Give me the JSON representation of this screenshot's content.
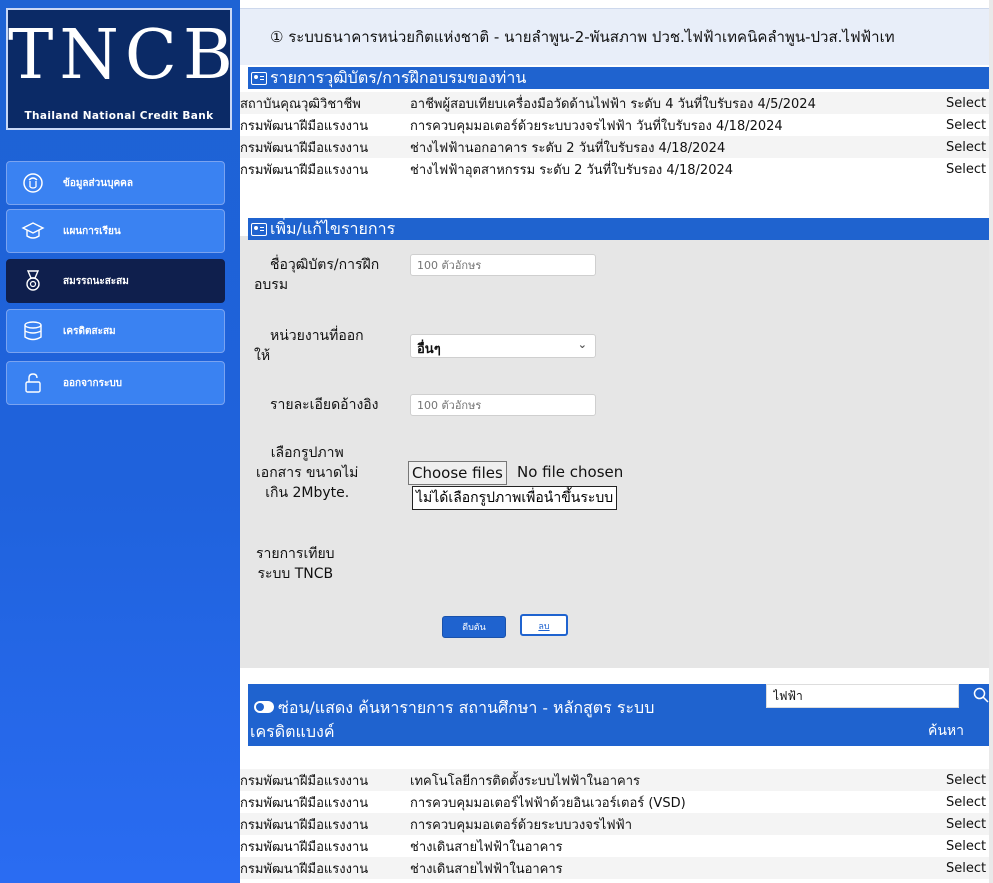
{
  "logo": {
    "title": "TNCB",
    "subtitle": "Thailand National Credit Bank"
  },
  "sidebar": {
    "items": [
      {
        "label": "ข้อมูลส่วนบุคคล",
        "icon": "profile-icon"
      },
      {
        "label": "แผนการเรียน",
        "icon": "graduation-cap-icon"
      },
      {
        "label": "สมรรถนะสะสม",
        "icon": "medal-icon",
        "active": true
      },
      {
        "label": "เครดิตสะสม",
        "icon": "database-icon"
      },
      {
        "label": "ออกจากระบบ",
        "icon": "unlock-icon"
      }
    ]
  },
  "header": {
    "text": "① ระบบธนาคารหน่วยกิตแห่งชาติ - นายลำพูน-2-พันสภาพ ปวช.ไฟฟ้าเทคนิคลำพูน-ปวส.ไฟฟ้าเท"
  },
  "certs": {
    "title": "รายการวุฒิบัตร/การฝึกอบรมของท่าน",
    "rows": [
      {
        "org": "สถาบันคุณวุฒิวิชาชีพ",
        "detail": "อาชีพผู้สอบเทียบเครื่องมือวัดด้านไฟฟ้า ระดับ 4 วันที่ใบรับรอง 4/5/2024",
        "action": "Select"
      },
      {
        "org": "กรมพัฒนาฝีมือแรงงาน",
        "detail": "การควบคุมมอเตอร์ด้วยระบบวงจรไฟฟ้า วันที่ใบรับรอง 4/18/2024",
        "action": "Select"
      },
      {
        "org": "กรมพัฒนาฝีมือแรงงาน",
        "detail": "ช่างไฟฟ้านอกอาคาร ระดับ 2 วันที่ใบรับรอง 4/18/2024",
        "action": "Select"
      },
      {
        "org": "กรมพัฒนาฝีมือแรงงาน",
        "detail": "ช่างไฟฟ้าอุตสาหกรรม ระดับ 2 วันที่ใบรับรอง 4/18/2024",
        "action": "Select"
      }
    ]
  },
  "form": {
    "title": "เพิ่ม/แก้ไขรายการ",
    "name_label_1": "ชื่อวุฒิบัตร/การฝึก",
    "name_label_2": "อบรม",
    "name_placeholder": "100 ตัวอักษร",
    "org_label_1": "หน่วยงานที่ออก",
    "org_label_2": "ให้",
    "org_value": "อื่นๆ",
    "ref_label": "รายละเอียดอ้างอิง",
    "ref_placeholder": "100 ตัวอักษร",
    "image_label_1": "เลือกรูปภาพ",
    "image_label_2": "เอกสาร ขนาดไม่",
    "image_label_3": "เกิน 2Mbyte.",
    "choose_files": "Choose files",
    "no_file": "No file chosen",
    "no_image_note": "ไม่ได้เลือกรูปภาพเพื่อนำขึ้นระบบ",
    "compare_label_1": "รายการเทียบ",
    "compare_label_2": "ระบบ TNCB",
    "submit": "ดีบตัน",
    "delete": "ลบ"
  },
  "search": {
    "title_line1": "ซ่อน/แสดง ค้นหารายการ สถานศึกษา - หลักสูตร ระบบ",
    "title_line2": "เครดิตแบงค์",
    "query": "ไฟฟ้า",
    "button_label": "ค้นหา",
    "rows": [
      {
        "org": "กรมพัฒนาฝีมือแรงงาน",
        "detail": "เทคโนโลยีการติดตั้งระบบไฟฟ้าในอาคาร",
        "action": "Select"
      },
      {
        "org": "กรมพัฒนาฝีมือแรงงาน",
        "detail": "การควบคุมมอเตอร์ไฟฟ้าด้วยอินเวอร์เตอร์ (VSD)",
        "action": "Select"
      },
      {
        "org": "กรมพัฒนาฝีมือแรงงาน",
        "detail": "การควบคุมมอเตอร์ด้วยระบบวงจรไฟฟ้า",
        "action": "Select"
      },
      {
        "org": "กรมพัฒนาฝีมือแรงงาน",
        "detail": "ช่างเดินสายไฟฟ้าในอาคาร",
        "action": "Select"
      },
      {
        "org": "กรมพัฒนาฝีมือแรงงาน",
        "detail": "ช่างเดินสายไฟฟ้าในอาคาร",
        "action": "Select"
      }
    ]
  },
  "colors": {
    "sidebar": "#1f62dc",
    "accent": "#1f63cf",
    "active_nav": "#0f1f4d"
  }
}
